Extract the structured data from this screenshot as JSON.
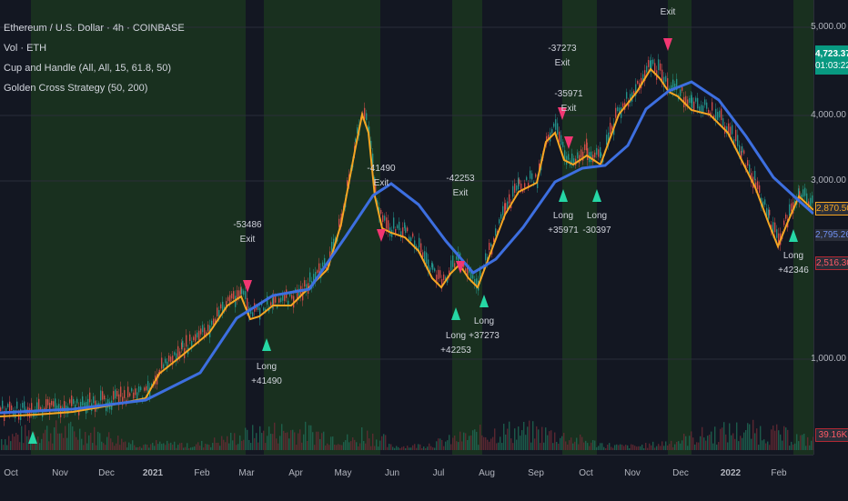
{
  "legend": {
    "symbol": "Ethereum / U.S. Dollar · 4h · COINBASE",
    "volume": "Vol · ETH",
    "indicator1": "Cup and Handle (All, All, 15, 61.8, 50)",
    "indicator2": "Golden Cross Strategy (50, 200)"
  },
  "price_axis": {
    "labels": [
      "5,000.00",
      "4,000.00",
      "3,000.00",
      "1,000.00"
    ],
    "current_price": "4,723.37",
    "countdown": "01:03:22",
    "ma_fast_value": "2,870.50",
    "ma_slow_value": "2,795.26",
    "stop_value": "2,516.30",
    "volume_value": "39.16K"
  },
  "time_axis": {
    "labels": [
      "Oct",
      "Nov",
      "Dec",
      "2021",
      "Feb",
      "Mar",
      "Apr",
      "May",
      "Jun",
      "Jul",
      "Aug",
      "Sep",
      "Oct",
      "Nov",
      "Dec",
      "2022",
      "Feb"
    ]
  },
  "signals": [
    {
      "kind": "exit",
      "text1": "-53486",
      "text2": "Exit"
    },
    {
      "kind": "exit",
      "text1": "-41490",
      "text2": "Exit"
    },
    {
      "kind": "exit",
      "text1": "-42253",
      "text2": "Exit"
    },
    {
      "kind": "exit",
      "text1": "-37273",
      "text2": "Exit"
    },
    {
      "kind": "exit",
      "text1": "-35971",
      "text2": "Exit"
    },
    {
      "kind": "exit",
      "text1": "",
      "text2": "Exit"
    },
    {
      "kind": "long",
      "text1": "Long",
      "text2": "+41490"
    },
    {
      "kind": "long",
      "text1": "Long",
      "text2": "+42253"
    },
    {
      "kind": "long",
      "text1": "Long",
      "text2": "+37273"
    },
    {
      "kind": "long",
      "text1": "Long",
      "text2": "+35971"
    },
    {
      "kind": "long",
      "text1": "Long",
      "text2": "-30397"
    },
    {
      "kind": "long",
      "text1": "Long",
      "text2": "+42346"
    }
  ],
  "colors": {
    "background": "#131722",
    "fast_ma": "#f5a623",
    "slow_ma": "#3d6fe0",
    "long_arrow": "#26d7a5",
    "exit_arrow": "#f23672",
    "current_price_tag": "#089981",
    "stop_tag": "#b22833",
    "volume_tag": "#b22833"
  }
}
